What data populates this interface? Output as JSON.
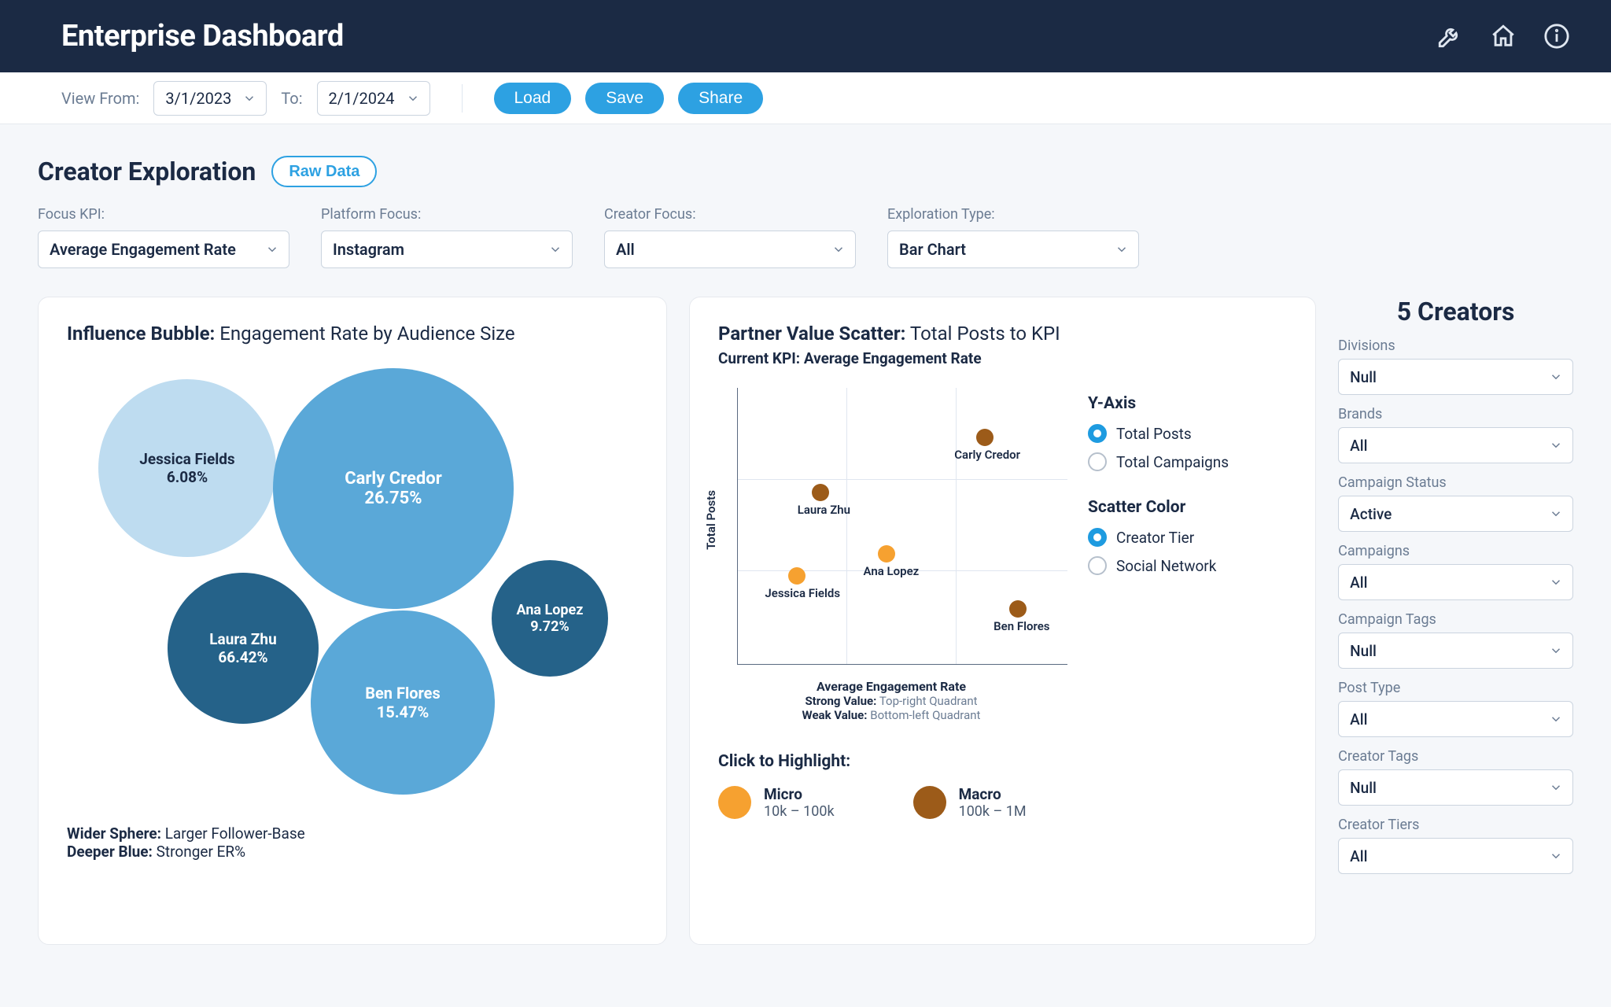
{
  "header": {
    "title": "Enterprise Dashboard"
  },
  "controlbar": {
    "view_from_label": "View From:",
    "date_from": "3/1/2023",
    "to_label": "To:",
    "date_to": "2/1/2024",
    "load": "Load",
    "save": "Save",
    "share": "Share"
  },
  "section": {
    "title": "Creator Exploration",
    "raw_data": "Raw Data"
  },
  "filters": {
    "focus_kpi": {
      "label": "Focus KPI:",
      "value": "Average Engagement Rate"
    },
    "platform_focus": {
      "label": "Platform Focus:",
      "value": "Instagram"
    },
    "creator_focus": {
      "label": "Creator Focus:",
      "value": "All"
    },
    "exploration_type": {
      "label": "Exploration Type:",
      "value": "Bar Chart"
    }
  },
  "bubble_card": {
    "title_bold": "Influence Bubble:",
    "title_rest": " Engagement Rate by Audience Size",
    "legend_a_bold": "Wider Sphere:",
    "legend_a_rest": " Larger Follower-Base",
    "legend_b_bold": "Deeper Blue:",
    "legend_b_rest": " Stronger ER%"
  },
  "scatter_card": {
    "title_bold": "Partner Value Scatter:",
    "title_rest": " Total Posts to KPI",
    "subtitle": "Current KPI: Average Engagement Rate",
    "y_axis_label": "Total Posts",
    "x_axis_label": "Average Engagement Rate",
    "strong_label": "Strong Value:",
    "strong_text": " Top-right Quadrant",
    "weak_label": "Weak Value:",
    "weak_text": " Bottom-left Quadrant",
    "opts": {
      "y_axis_head": "Y-Axis",
      "y1": "Total Posts",
      "y2": "Total Campaigns",
      "color_head": "Scatter Color",
      "c1": "Creator Tier",
      "c2": "Social Network"
    },
    "highlight_head": "Click to Highlight:",
    "micro_label": "Micro",
    "micro_range": "10k – 100k",
    "macro_label": "Macro",
    "macro_range": "100k – 1M"
  },
  "sidebar": {
    "title": "5 Creators",
    "groups": {
      "divisions": {
        "label": "Divisions",
        "value": "Null"
      },
      "brands": {
        "label": "Brands",
        "value": "All"
      },
      "campaign_status": {
        "label": "Campaign Status",
        "value": "Active"
      },
      "campaigns": {
        "label": "Campaigns",
        "value": "All"
      },
      "campaign_tags": {
        "label": "Campaign Tags",
        "value": "Null"
      },
      "post_type": {
        "label": "Post Type",
        "value": "All"
      },
      "creator_tags": {
        "label": "Creator Tags",
        "value": "Null"
      },
      "creator_tiers": {
        "label": "Creator Tiers",
        "value": "All"
      }
    }
  },
  "colors": {
    "micro": "#f6a130",
    "macro": "#9c5b19"
  },
  "chart_data": [
    {
      "type": "bubble",
      "title": "Influence Bubble: Engagement Rate by Audience Size",
      "size_meaning": "follower base",
      "color_meaning": "engagement rate percent",
      "series": [
        {
          "name": "Jessica Fields",
          "engagement_rate_pct": 6.08,
          "size_rel": 0.6,
          "shade": "light"
        },
        {
          "name": "Carly Credor",
          "engagement_rate_pct": 26.75,
          "size_rel": 1.0,
          "shade": "mid"
        },
        {
          "name": "Laura Zhu",
          "engagement_rate_pct": 66.42,
          "size_rel": 0.55,
          "shade": "dark"
        },
        {
          "name": "Ben Flores",
          "engagement_rate_pct": 15.47,
          "size_rel": 0.7,
          "shade": "mid"
        },
        {
          "name": "Ana Lopez",
          "engagement_rate_pct": 9.72,
          "size_rel": 0.4,
          "shade": "dark"
        }
      ]
    },
    {
      "type": "scatter",
      "title": "Partner Value Scatter: Total Posts to KPI",
      "xlabel": "Average Engagement Rate",
      "ylabel": "Total Posts",
      "xlim": [
        0,
        100
      ],
      "ylim": [
        0,
        100
      ],
      "series": [
        {
          "name": "Micro",
          "color": "#f6a130",
          "points": [
            {
              "label": "Jessica Fields",
              "x": 18,
              "y": 32
            },
            {
              "label": "Ana Lopez",
              "x": 45,
              "y": 40
            }
          ]
        },
        {
          "name": "Macro",
          "color": "#9c5b19",
          "points": [
            {
              "label": "Laura Zhu",
              "x": 25,
              "y": 62
            },
            {
              "label": "Carly Credor",
              "x": 75,
              "y": 82
            },
            {
              "label": "Ben Flores",
              "x": 85,
              "y": 20
            }
          ]
        }
      ]
    }
  ]
}
